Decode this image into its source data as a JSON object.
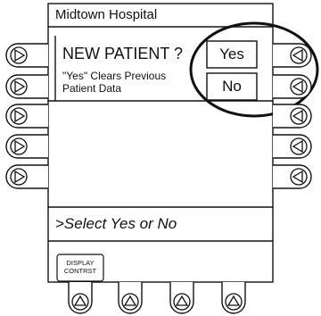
{
  "hospital_name": "Midtown Hospital",
  "prompt": {
    "question": "NEW PATIENT ?",
    "note_line1": "\"Yes\" Clears Previous",
    "note_line2": "Patient Data"
  },
  "choices": {
    "yes": "Yes",
    "no": "No"
  },
  "status_message": ">Select Yes or No",
  "soft_keys": {
    "display_label_1": "DISPLAY",
    "display_label_2": "CONTRST"
  },
  "icons": {
    "left_keys": "triangle-right-icon",
    "right_keys": "triangle-left-icon",
    "bottom_keys": "triangle-up-icon"
  },
  "colors": {
    "line": "#111111",
    "background": "#ffffff"
  }
}
